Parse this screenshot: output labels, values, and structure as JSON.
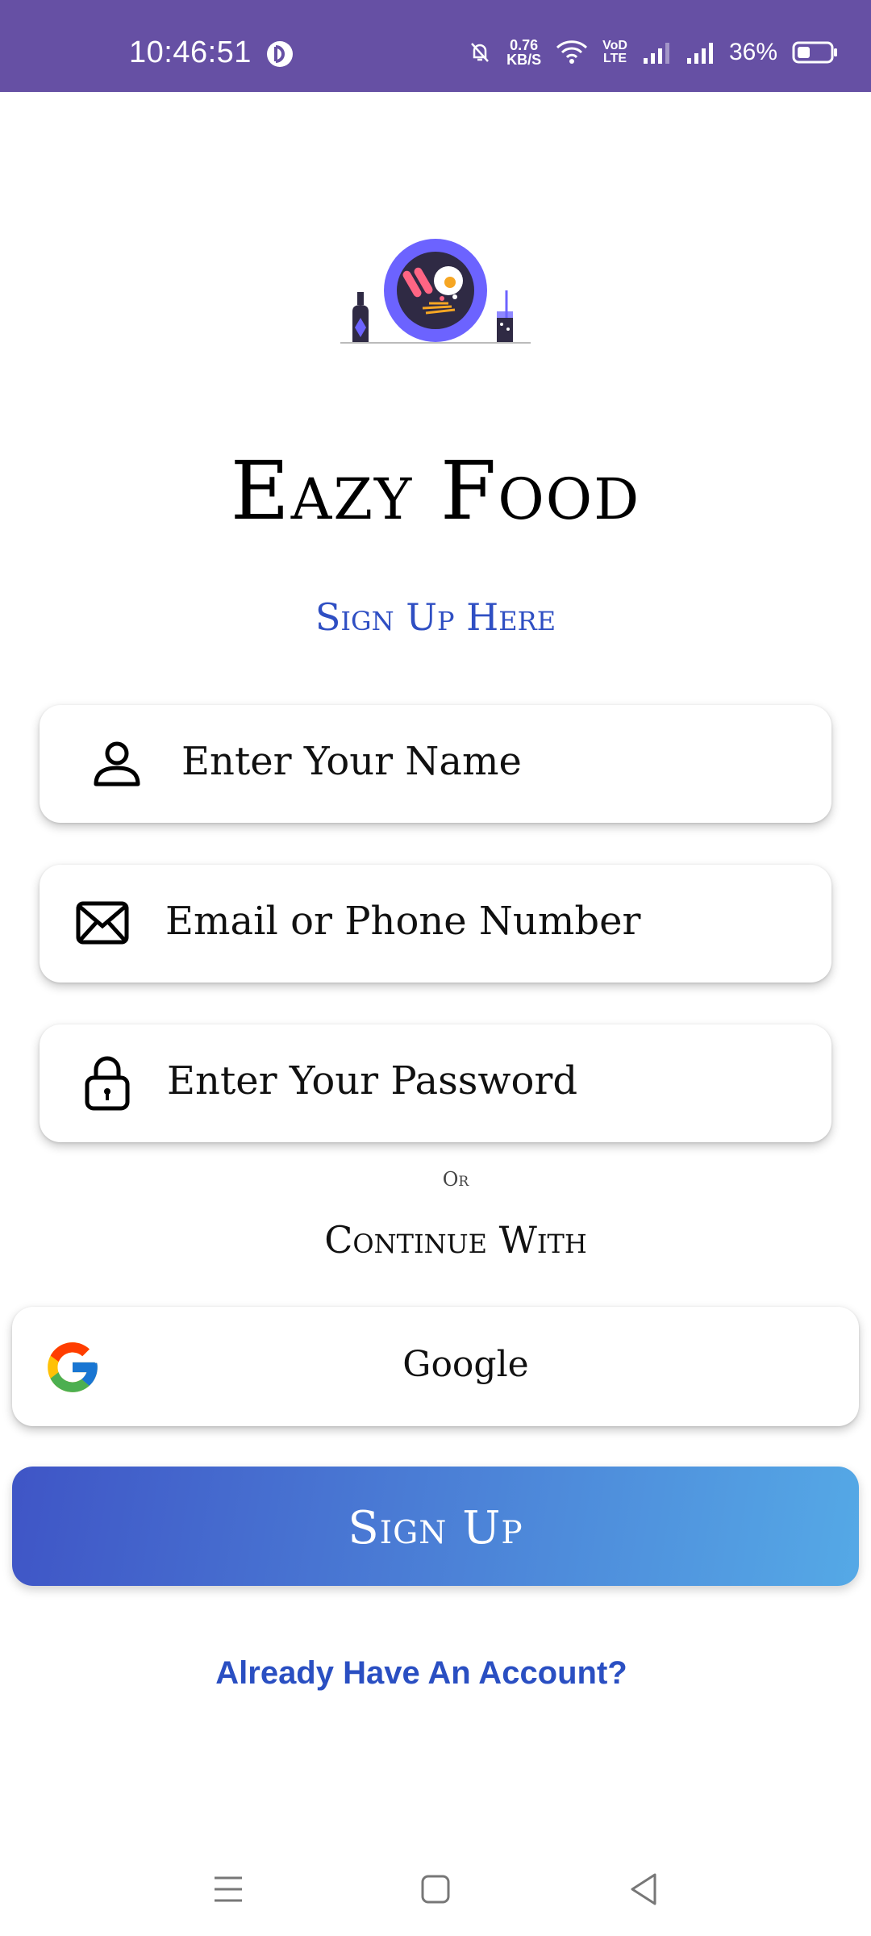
{
  "status_bar": {
    "time": "10:46:51",
    "net_speed_value": "0.76",
    "net_speed_unit": "KB/S",
    "volte_top": "VoD",
    "volte_bottom": "LTE",
    "battery_percent": "36%"
  },
  "app": {
    "title": "Eazy Food",
    "subtitle": "Sign Up Here"
  },
  "form": {
    "name_placeholder": "Enter Your Name",
    "email_placeholder": "Email or Phone Number",
    "password_placeholder": "Enter Your Password"
  },
  "divider": {
    "or_label": "Or",
    "continue_label": "Continue With"
  },
  "buttons": {
    "google_label": "Google",
    "signup_label": "Sign Up",
    "login_link": "Already Have An Account?"
  },
  "colors": {
    "status_bar": "#6650a4",
    "accent_blue": "#2f4fc3",
    "gradient_start": "#3f55c6",
    "gradient_end": "#55a9e6"
  },
  "icons": {
    "name_field": "person-icon",
    "email_field": "mail-icon",
    "password_field": "lock-icon",
    "google": "google-icon",
    "nav": [
      "menu-icon",
      "home-square-icon",
      "back-triangle-icon"
    ]
  }
}
